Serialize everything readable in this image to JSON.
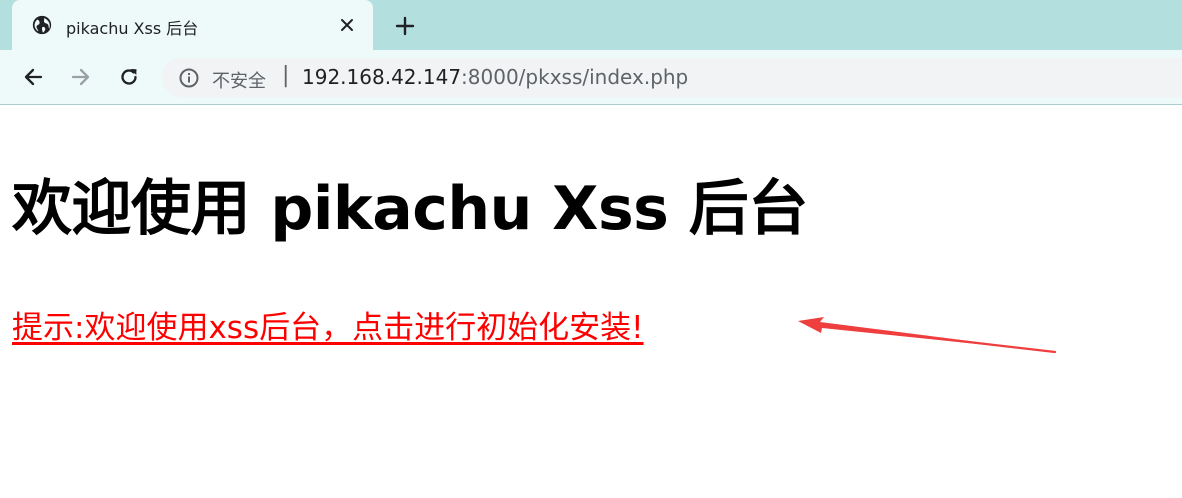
{
  "browser": {
    "tab": {
      "title": "pikachu Xss 后台",
      "favicon": "globe-icon",
      "close_icon": "close-icon"
    },
    "new_tab_icon": "plus-icon",
    "nav": {
      "back_icon": "arrow-left-icon",
      "forward_icon": "arrow-right-icon",
      "reload_icon": "reload-icon"
    },
    "address_bar": {
      "security_icon": "info-icon",
      "security_label": "不安全",
      "separator": "|",
      "url_host": "192.168.42.147",
      "url_rest": ":8000/pkxss/index.php"
    }
  },
  "page": {
    "heading": "欢迎使用 pikachu Xss 后台",
    "install_link": "提示:欢迎使用xss后台，点击进行初始化安装!",
    "link_color": "#ff0000",
    "annotation": "red-arrow-icon"
  },
  "colors": {
    "tabstrip": "#b3e0df",
    "toolbar": "#eefaf9",
    "omnibox": "#f1f3f4",
    "arrow": "#ef3e3e"
  }
}
